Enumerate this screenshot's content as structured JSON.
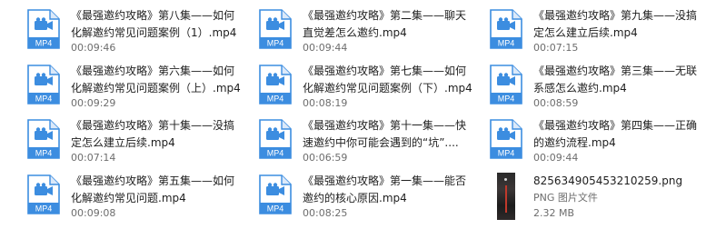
{
  "files": [
    {
      "title": "《最强邀约攻略》第八集——如何化解邀约常见问题案例（1）.mp4",
      "duration": "00:09:46",
      "icon": "mp4-file-icon",
      "badge": "MP4"
    },
    {
      "title": "《最强邀约攻略》第二集——聊天直觉差怎么邀约.mp4",
      "duration": "00:09:44",
      "icon": "mp4-file-icon",
      "badge": "MP4"
    },
    {
      "title": "《最强邀约攻略》第九集——没搞定怎么建立后续.mp4",
      "duration": "00:07:15",
      "icon": "mp4-file-icon",
      "badge": "MP4"
    },
    {
      "title": "《最强邀约攻略》第六集——如何化解邀约常见问题案例（上）.mp4",
      "duration": "00:09:29",
      "icon": "mp4-file-icon",
      "badge": "MP4"
    },
    {
      "title": "《最强邀约攻略》第七集——如何化解邀约常见问题案例（下）.mp4",
      "duration": "00:08:19",
      "icon": "mp4-file-icon",
      "badge": "MP4"
    },
    {
      "title": "《最强邀约攻略》第三集——无联系感怎么邀约.mp4",
      "duration": "00:08:59",
      "icon": "mp4-file-icon",
      "badge": "MP4"
    },
    {
      "title": "《最强邀约攻略》第十集——没搞定怎么建立后续.mp4",
      "duration": "00:07:14",
      "icon": "mp4-file-icon",
      "badge": "MP4"
    },
    {
      "title": "《最强邀约攻略》第十一集——快速邀约中你可能会遇到的“坑”....",
      "duration": "00:06:59",
      "icon": "mp4-file-icon",
      "badge": "MP4"
    },
    {
      "title": "《最强邀约攻略》第四集——正确的邀约流程.mp4",
      "duration": "00:09:44",
      "icon": "mp4-file-icon",
      "badge": "MP4"
    },
    {
      "title": "《最强邀约攻略》第五集——如何化解邀约常见问题.mp4",
      "duration": "00:09:08",
      "icon": "mp4-file-icon",
      "badge": "MP4"
    },
    {
      "title": "《最强邀约攻略》第一集——能否邀约的核心原因.mp4",
      "duration": "00:08:25",
      "icon": "mp4-file-icon",
      "badge": "MP4"
    }
  ],
  "image_file": {
    "name": "825634905453210259.png",
    "type": "PNG 图片文件",
    "size": "2.32 MB",
    "icon": "image-thumbnail"
  },
  "colors": {
    "icon_blue": "#3c8de0",
    "badge_bg": "#3c8de0"
  }
}
